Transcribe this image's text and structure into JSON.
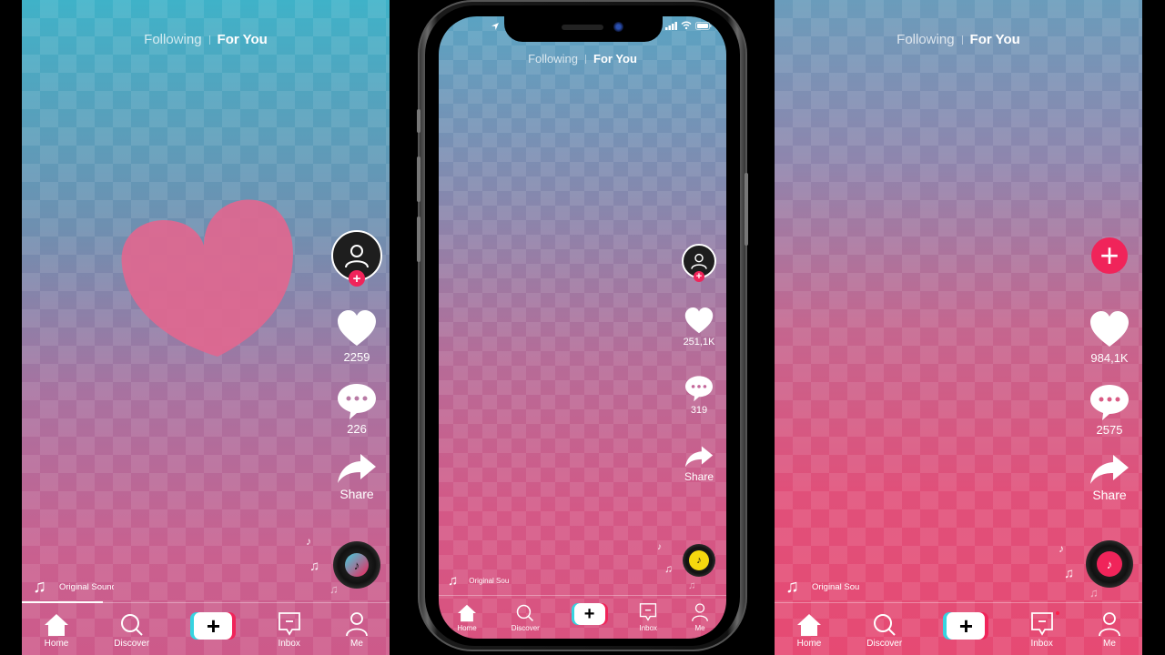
{
  "top_tabs": {
    "following": "Following",
    "for_you": "For You"
  },
  "panels": [
    {
      "id": "left",
      "likes": "2259",
      "comments": "226",
      "share": "Share",
      "sound": "Original Sound",
      "disc_color": "#3fd0e0"
    },
    {
      "id": "phone",
      "likes": "251,1K",
      "comments": "319",
      "share": "Share",
      "sound": "Original Sou",
      "disc_color": "#f5d80e"
    },
    {
      "id": "right",
      "likes": "984,1K",
      "comments": "2575",
      "share": "Share",
      "sound": "Original Sou",
      "disc_color": "#f0245a"
    }
  ],
  "nav": {
    "home": "Home",
    "discover": "Discover",
    "create": "+",
    "inbox": "Inbox",
    "me": "Me"
  },
  "icons": {
    "note": "♫",
    "note_single": "♪",
    "plus": "+"
  },
  "colors": {
    "accent_red": "#f0245a",
    "accent_cyan": "#36d4e0",
    "big_heart": "#e0678f"
  },
  "playback_progress": 0.22
}
